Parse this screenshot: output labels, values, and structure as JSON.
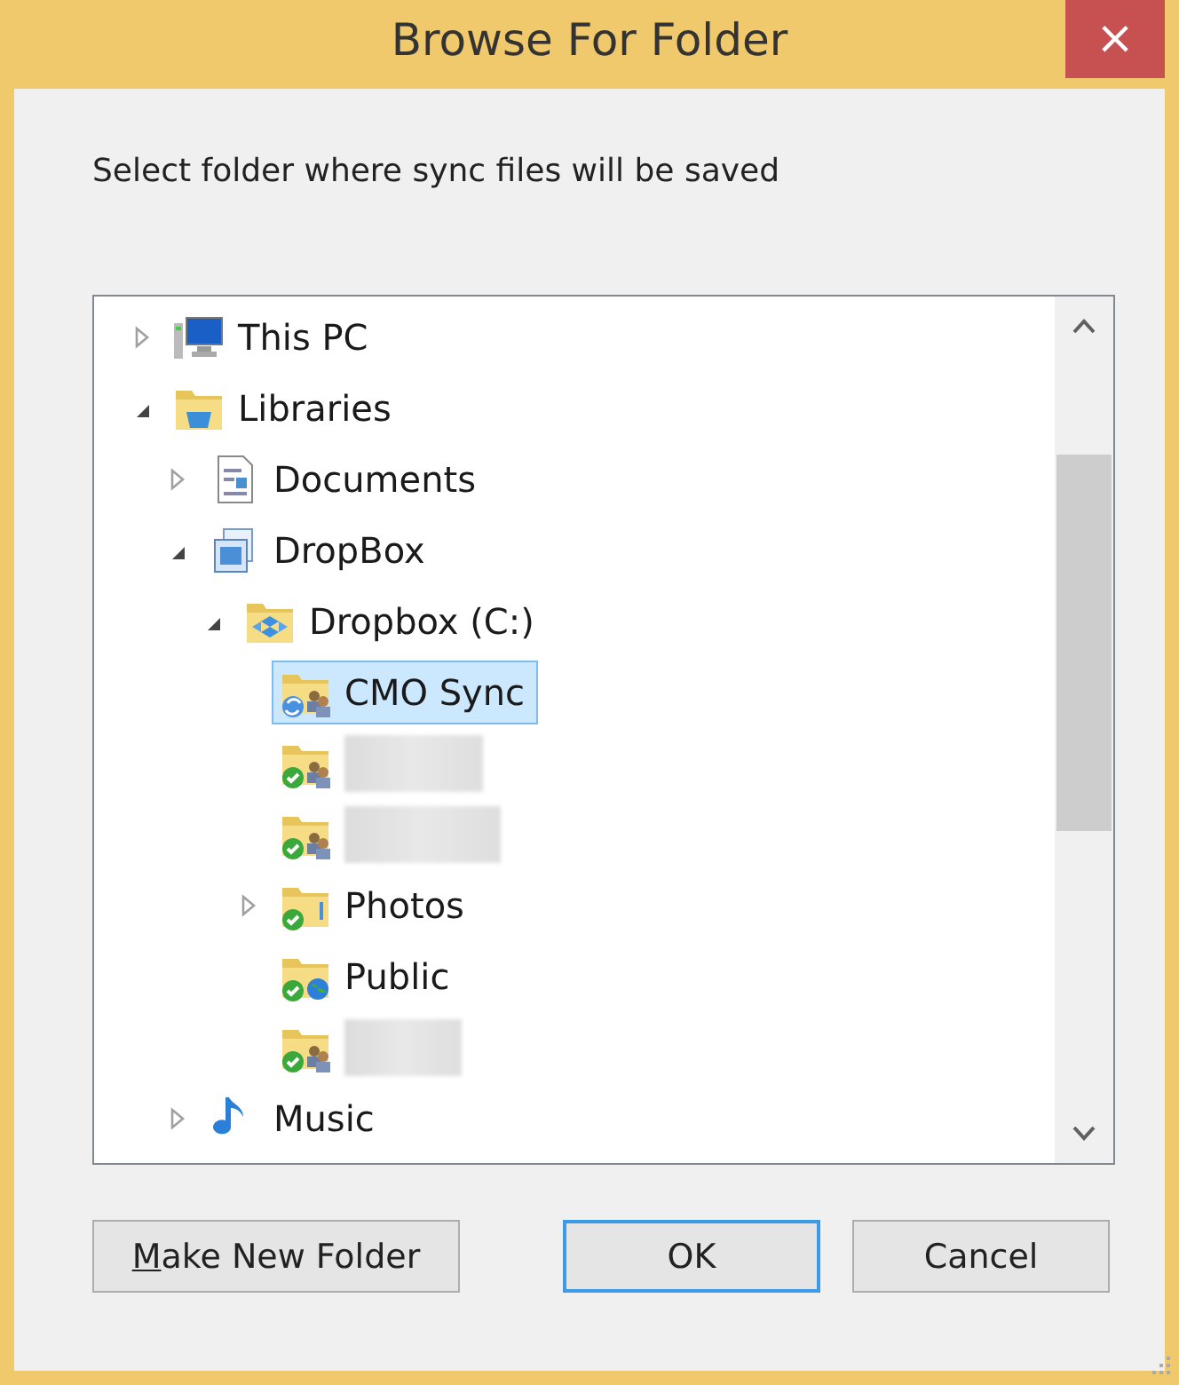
{
  "window": {
    "title": "Browse For Folder",
    "close": "×"
  },
  "prompt": "Select folder where sync files will be saved",
  "tree": [
    {
      "label": "This PC",
      "kind": "computer",
      "has_children": true,
      "expanded": false,
      "selected": false
    },
    {
      "label": "Libraries",
      "kind": "library",
      "has_children": true,
      "expanded": true,
      "selected": false,
      "children": [
        {
          "label": "Documents",
          "kind": "document",
          "has_children": true,
          "expanded": false,
          "selected": false
        },
        {
          "label": "DropBox",
          "kind": "library-folder",
          "has_children": true,
          "expanded": true,
          "selected": false,
          "children": [
            {
              "label": "Dropbox (C:)",
              "kind": "dropbox-folder",
              "has_children": true,
              "expanded": true,
              "selected": false,
              "children": [
                {
                  "label": "CMO Sync",
                  "kind": "sync-folder",
                  "has_children": false,
                  "selected": true
                },
                {
                  "kind": "shared-folder",
                  "redacted": true,
                  "has_children": false,
                  "selected": false
                },
                {
                  "kind": "shared-folder",
                  "redacted": true,
                  "has_children": false,
                  "selected": false
                },
                {
                  "label": "Photos",
                  "kind": "synced-folder",
                  "has_children": true,
                  "expanded": false,
                  "selected": false
                },
                {
                  "label": "Public",
                  "kind": "public-folder",
                  "has_children": false,
                  "selected": false
                },
                {
                  "kind": "shared-folder",
                  "redacted": true,
                  "has_children": false,
                  "selected": false
                }
              ]
            }
          ]
        },
        {
          "label": "Music",
          "kind": "music",
          "has_children": true,
          "expanded": false,
          "selected": false
        }
      ]
    }
  ],
  "buttons": [
    {
      "label": "Make New Folder",
      "mnemonic": true,
      "default": false
    },
    {
      "label": "OK",
      "mnemonic": false,
      "default": true
    },
    {
      "label": "Cancel",
      "mnemonic": false,
      "default": false
    }
  ]
}
